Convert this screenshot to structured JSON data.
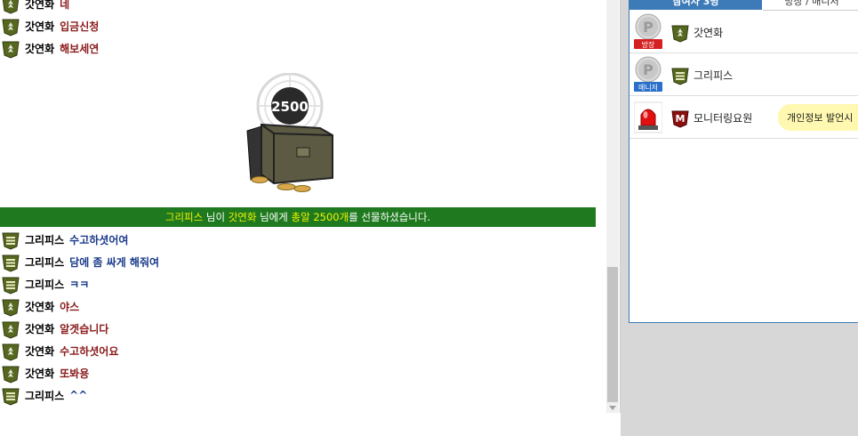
{
  "chat": {
    "messages": [
      {
        "nick": "갓연화",
        "text": "네",
        "rank": "green",
        "color": "red"
      },
      {
        "nick": "갓연화",
        "text": "입금신청",
        "rank": "green",
        "color": "red"
      },
      {
        "nick": "갓연화",
        "text": "해보세연",
        "rank": "green",
        "color": "red"
      },
      {
        "nick": "그리피스",
        "text": "수고하셧어여",
        "rank": "stripe",
        "color": "blue"
      },
      {
        "nick": "그리피스",
        "text": "담에 좀 싸게 해줘여",
        "rank": "stripe",
        "color": "blue"
      },
      {
        "nick": "그리피스",
        "text": "ㅋㅋ",
        "rank": "stripe",
        "color": "blue"
      },
      {
        "nick": "갓연화",
        "text": "야스",
        "rank": "green",
        "color": "red"
      },
      {
        "nick": "갓연화",
        "text": "알겟습니다",
        "rank": "green",
        "color": "red"
      },
      {
        "nick": "갓연화",
        "text": "수고하셧어요",
        "rank": "green",
        "color": "red"
      },
      {
        "nick": "갓연화",
        "text": "또봐용",
        "rank": "green",
        "color": "red"
      },
      {
        "nick": "그리피스",
        "text": "^^",
        "rank": "stripe",
        "color": "blue"
      }
    ],
    "gift": {
      "amount": "2500",
      "sender": "그리피스",
      "part1": "님이",
      "receiver": "갓연화",
      "part2": "님에게",
      "item": "총알 2500개",
      "part3": "를 선물하셨습니다."
    }
  },
  "userlist": {
    "tab_active": "참여자 3명",
    "tab_inactive": "방장 / 매니저",
    "users": [
      {
        "name": "갓연화",
        "badge": "방장",
        "badge_color": "#d42020",
        "role_icon": "p-icon",
        "rank": "green"
      },
      {
        "name": "그리피스",
        "badge": "매니저",
        "badge_color": "#2a6fc9",
        "role_icon": "p-icon",
        "rank": "stripe"
      },
      {
        "name": "모니터링요원",
        "badge": "",
        "role_icon": "siren-icon",
        "rank": "m-badge",
        "tooltip": "개인정보 발언시"
      }
    ]
  },
  "colors": {
    "banner": "#1f7a1f",
    "highlight": "#f2f200",
    "accent": "#3d7ab8"
  }
}
